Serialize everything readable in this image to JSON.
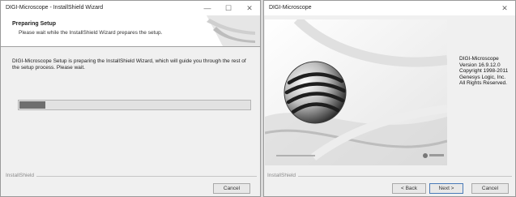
{
  "installer": {
    "title": "DIGI-Microscope - InstallShield Wizard",
    "minimize": "—",
    "maximize": "☐",
    "close": "✕",
    "heading": "Preparing Setup",
    "subheading": "Please wait while the InstallShield Wizard prepares the setup.",
    "message": "DIGI-Microscope Setup is preparing the InstallShield Wizard, which will guide you through the rest of the setup process. Please wait.",
    "progress": 0.12,
    "brand": "InstallShield",
    "cancel": "Cancel"
  },
  "splash_window": {
    "title": "DIGI-Microscope",
    "close": "✕",
    "info": [
      "DIGI-Microscope",
      "Version 16.9.12.0",
      "Copyright 1998-2011",
      "Genesys Logic, Inc.",
      "All Rights Reserved."
    ],
    "brand": "InstallShield",
    "back": "< Back",
    "next": "Next >",
    "cancel": "Cancel"
  }
}
